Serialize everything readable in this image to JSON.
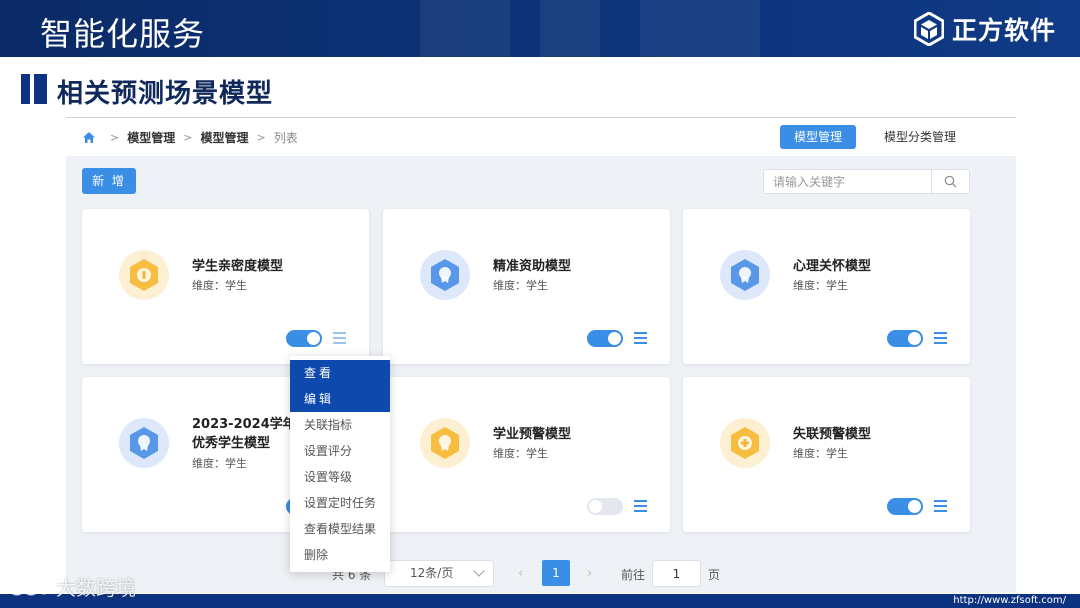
{
  "slide": {
    "title": "智能化服务",
    "brand_name": "正方软件",
    "section_title": "相关预测场景模型",
    "footer_url": "http://www.zfsoft.com/",
    "watermark_text": "大数跨境"
  },
  "breadcrumb": [
    "模型管理",
    "模型管理",
    "列表"
  ],
  "header_tabs": {
    "active": "模型管理",
    "other": "模型分类管理"
  },
  "toolbar": {
    "add_label": "新 增",
    "search_placeholder": "请输入关键字"
  },
  "colors": {
    "primary": "#3a8ee6",
    "menu_highlight": "#0e4aae",
    "banner": "#0d3380",
    "icon_gold": "#f5b731",
    "icon_blue": "#4a8fe7"
  },
  "cards": [
    {
      "name": "学生亲密度模型",
      "dimension": "维度：学生",
      "icon": "gold-hexagon-badge-icon",
      "enabled": true
    },
    {
      "name": "精准资助模型",
      "dimension": "维度：学生",
      "icon": "blue-hexagon-badge-icon",
      "enabled": true
    },
    {
      "name": "心理关怀模型",
      "dimension": "维度：学生",
      "icon": "blue-hexagon-badge-icon",
      "enabled": true
    },
    {
      "name_line1": "2023-2024学年页",
      "name_line2": "优秀学生模型",
      "dimension": "维度：学生",
      "icon": "blue-hexagon-badge-icon",
      "enabled": true
    },
    {
      "name": "学业预警模型",
      "dimension": "维度：学生",
      "icon": "gold-hexagon-badge-icon",
      "enabled": false
    },
    {
      "name": "失联预警模型",
      "dimension": "维度：学生",
      "icon": "gold-hexagon-badge-icon",
      "enabled": true
    }
  ],
  "dropdown_menu": [
    "查看",
    "编辑",
    "关联指标",
    "设置评分",
    "设置等级",
    "设置定时任务",
    "查看模型结果",
    "删除"
  ],
  "pagination": {
    "total_text": "共 6 条",
    "page_size": "12条/页",
    "prev": "‹",
    "current_page": "1",
    "next": "›",
    "goto_label": "前往",
    "goto_value": "1",
    "page_unit": "页"
  }
}
